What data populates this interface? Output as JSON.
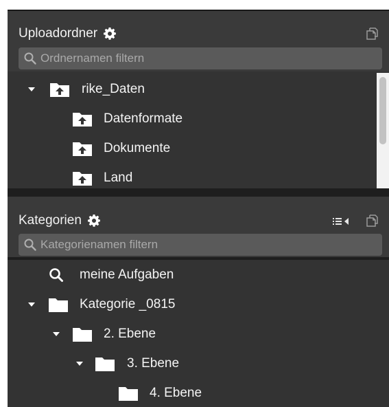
{
  "upload_panel": {
    "title": "Uploadordner",
    "search_placeholder": "Ordnernamen filtern",
    "items": [
      {
        "label": "rike_Daten",
        "expanded": true,
        "icon": "upload-folder-icon"
      },
      {
        "label": "Datenformate",
        "icon": "upload-folder-icon"
      },
      {
        "label": "Dokumente",
        "icon": "upload-folder-icon"
      },
      {
        "label": "Land",
        "icon": "upload-folder-icon"
      }
    ]
  },
  "category_panel": {
    "title": "Kategorien",
    "search_placeholder": "Kategorienamen filtern",
    "items": [
      {
        "label": "meine Aufgaben",
        "icon": "search-icon"
      },
      {
        "label": "Kategorie _0815",
        "expanded": true,
        "icon": "folder-icon"
      },
      {
        "label": "2. Ebene",
        "expanded": true,
        "icon": "folder-icon"
      },
      {
        "label": "3. Ebene",
        "expanded": true,
        "icon": "folder-icon"
      },
      {
        "label": "4. Ebene",
        "icon": "folder-icon"
      }
    ]
  },
  "colors": {
    "panel_bg": "#333333",
    "header_bg": "#3a3a3a",
    "search_bg": "#5a5a5a",
    "text": "#f4f4f4",
    "placeholder": "#a9a9a9",
    "scrollbar_track": "#f2f2f2",
    "scrollbar_thumb": "#c2c2c2"
  }
}
